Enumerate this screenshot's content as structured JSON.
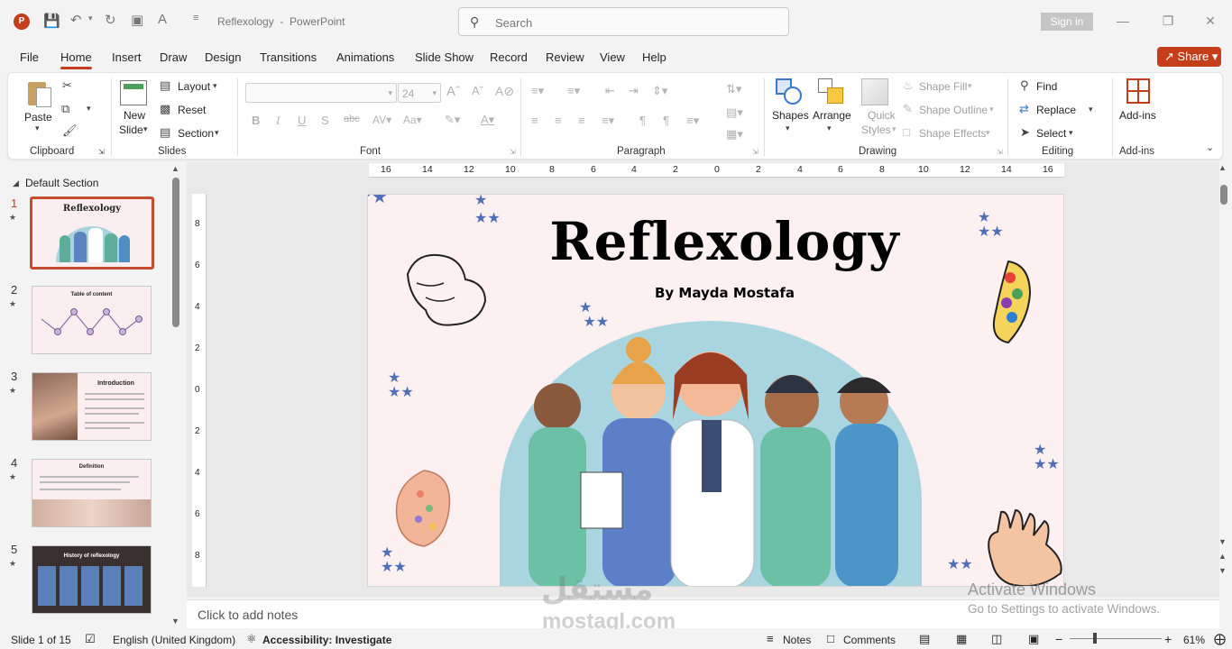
{
  "titlebar": {
    "doc_title": "Reflexology",
    "separator": "-",
    "app_name": "PowerPoint",
    "search_placeholder": "Search",
    "sign_in": "Sign in",
    "app_icon": "powerpoint-logo-icon"
  },
  "menu": {
    "tabs": [
      "File",
      "Home",
      "Insert",
      "Draw",
      "Design",
      "Transitions",
      "Animations",
      "Slide Show",
      "Record",
      "Review",
      "View",
      "Help"
    ],
    "active": "Home",
    "share": "Share"
  },
  "ribbon": {
    "clipboard": {
      "label": "Clipboard",
      "paste": "Paste"
    },
    "slides": {
      "label": "Slides",
      "new_slide_1": "New",
      "new_slide_2": "Slide",
      "layout": "Layout",
      "reset": "Reset",
      "section": "Section"
    },
    "font": {
      "label": "Font",
      "size": "24"
    },
    "paragraph": {
      "label": "Paragraph"
    },
    "drawing": {
      "label": "Drawing",
      "shapes": "Shapes",
      "arrange": "Arrange",
      "quick_styles_1": "Quick",
      "quick_styles_2": "Styles",
      "shape_fill": "Shape Fill",
      "shape_outline": "Shape Outline",
      "shape_effects": "Shape Effects"
    },
    "editing": {
      "label": "Editing",
      "find": "Find",
      "replace": "Replace",
      "select": "Select"
    },
    "addins": {
      "label": "Add-ins",
      "button": "Add-ins"
    }
  },
  "thumbnails": {
    "section": "Default Section",
    "slides": [
      {
        "num": "1",
        "title": "Reflexology"
      },
      {
        "num": "2",
        "title": "Table of content"
      },
      {
        "num": "3",
        "title": "Introduction"
      },
      {
        "num": "4",
        "title": "Definition"
      },
      {
        "num": "5",
        "title": "History of reflexology"
      }
    ]
  },
  "ruler": {
    "top_ticks": [
      "16",
      "14",
      "12",
      "10",
      "8",
      "6",
      "4",
      "2",
      "0",
      "2",
      "4",
      "6",
      "8",
      "10",
      "12",
      "14",
      "16"
    ],
    "left_ticks": [
      "8",
      "6",
      "4",
      "2",
      "0",
      "2",
      "4",
      "6",
      "8"
    ]
  },
  "slide": {
    "title": "Reflexology",
    "subtitle": "By Mayda Mostafa",
    "colors": {
      "background": "#fcf0f1",
      "star": "#4f6fb8",
      "accent": "#c43e1c"
    }
  },
  "notes": {
    "placeholder": "Click to add notes"
  },
  "watermark": {
    "activate_title": "Activate Windows",
    "activate_sub": "Go to Settings to activate Windows.",
    "site": "mostaql.com",
    "arabic": "مستقل"
  },
  "status": {
    "slide_info": "Slide 1 of 15",
    "language": "English (United Kingdom)",
    "accessibility": "Accessibility: Investigate",
    "notes": "Notes",
    "comments": "Comments",
    "zoom": "61%"
  }
}
